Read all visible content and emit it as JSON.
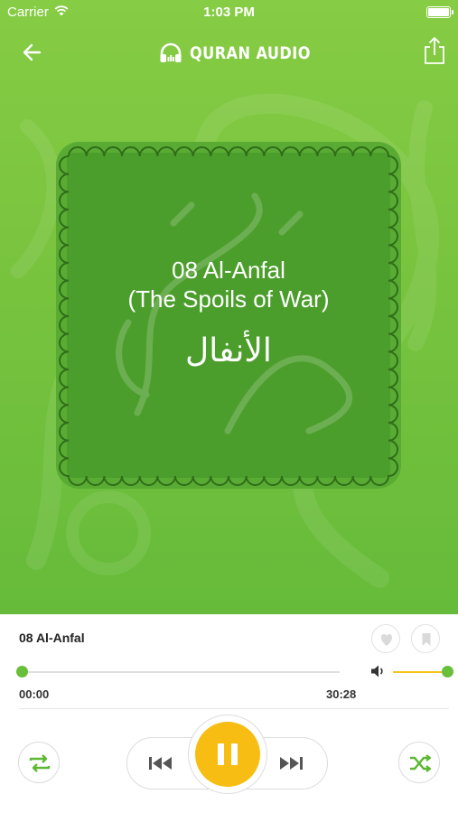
{
  "status_bar": {
    "carrier": "Carrier",
    "time": "1:03 PM"
  },
  "header": {
    "brand": "QURAN AUDIO",
    "back_icon": "arrow-left-icon",
    "share_icon": "share-icon",
    "logo_icon": "headphones-icon"
  },
  "artwork": {
    "title": "08 Al-Anfal",
    "subtitle": "(The Spoils of War)",
    "arabic": "الأنفال"
  },
  "player": {
    "track_title": "08 Al-Anfal",
    "elapsed": "00:00",
    "total": "30:28",
    "progress": 0,
    "volume": 1.0,
    "favorite_icon": "heart-icon",
    "bookmark_icon": "bookmark-icon",
    "volume_icon": "speaker-icon",
    "repeat_icon": "repeat-icon",
    "shuffle_icon": "shuffle-icon",
    "previous_icon": "skip-previous-icon",
    "pause_icon": "pause-icon",
    "next_icon": "skip-next-icon"
  },
  "colors": {
    "green": "#7ac43f",
    "card_green": "#4c9e2c",
    "accent_yellow": "#f7bd13",
    "knob_green": "#68bf3a"
  }
}
